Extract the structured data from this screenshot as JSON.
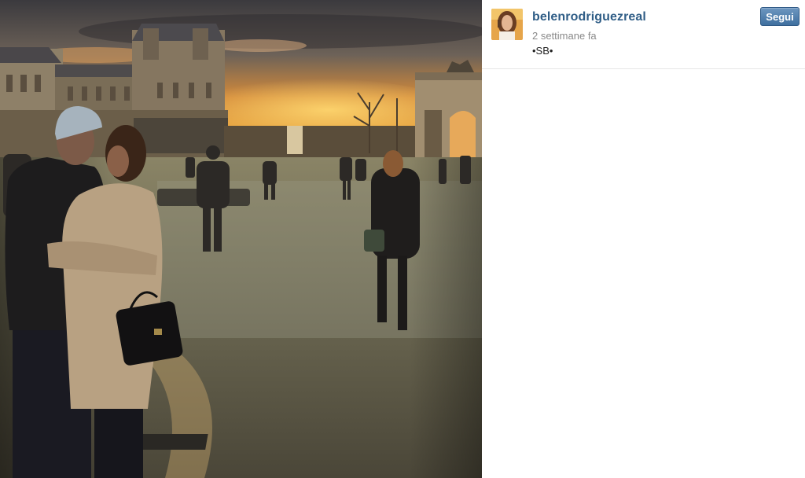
{
  "post": {
    "username": "belenrodriguezreal",
    "timestamp": "2 settimane fa",
    "caption": "•SB•",
    "follow_label": "Segui"
  },
  "colors": {
    "username": "#2f5d86",
    "follow_button": "#4f7eae",
    "timestamp": "#8a8a8a"
  }
}
